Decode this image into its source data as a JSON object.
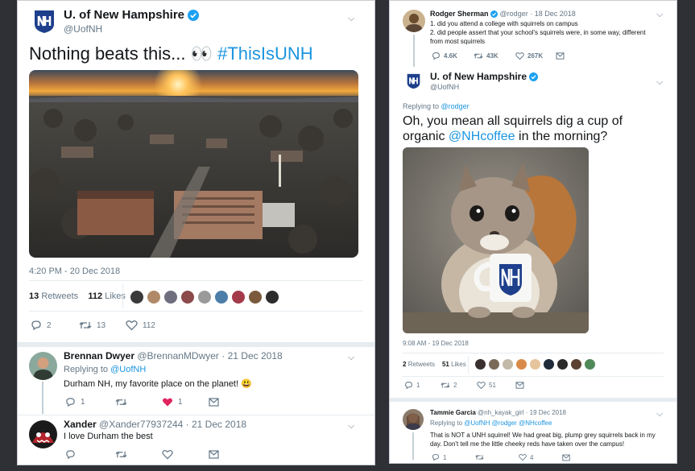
{
  "left": {
    "tweet": {
      "name": "U. of New Hampshire",
      "handle": "@UofNH",
      "text_main": "Nothing beats this... 👀 ",
      "hashtag": "#ThisIsUNH",
      "timestamp": "4:20 PM - 20 Dec 2018",
      "retweets_count": "13",
      "retweets_label": "Retweets",
      "likes_count": "112",
      "likes_label": "Likes",
      "reply_count": "2",
      "retweet_count": "13",
      "like_count": "112"
    },
    "replies": [
      {
        "name": "Brennan Dwyer",
        "handle": "@BrennanMDwyer",
        "date": "· 21 Dec 2018",
        "replying_prefix": "Replying to ",
        "replying_to": "@UofNH",
        "text": "Durham NH, my favorite place on the planet! 😃",
        "reply_count": "1",
        "retweet_count": "",
        "like_count": "1"
      },
      {
        "name": "Xander",
        "handle": "@Xander77937244",
        "date": "· 21 Dec 2018",
        "text": "I love Durham the best"
      }
    ]
  },
  "right": {
    "parent": {
      "name": "Rodger Sherman",
      "handle": "@rodger",
      "date": "· 18 Dec 2018",
      "line1": "1. did you attend a college with squirrels on campus",
      "line2": "2. did people assert that your school's squirrels were, in some way, different from most squirrels",
      "reply_count": "4.6K",
      "retweet_count": "43K",
      "like_count": "267K"
    },
    "tweet": {
      "name": "U. of New Hampshire",
      "handle": "@UofNH",
      "replying_prefix": "Replying to ",
      "replying_to": "@rodger",
      "text_pre": "Oh, you mean all squirrels dig a cup of organic ",
      "mention": "@NHcoffee",
      "text_post": " in the morning?",
      "timestamp": "9:08 AM - 19 Dec 2018",
      "retweets_count": "2",
      "retweets_label": "Retweets",
      "likes_count": "51",
      "likes_label": "Likes",
      "reply_count": "1",
      "retweet_count": "2",
      "like_count": "51"
    },
    "reply": {
      "name": "Tammie Garcia",
      "handle": "@nh_kayak_girl",
      "date": "· 19 Dec 2018",
      "replying_prefix": "Replying to ",
      "replying_to": "@UofNH @rodger @NHcoffee",
      "text": "That is NOT a UNH squirrel! We had great big, plump grey squirrels back in my day. Don't tell me the little cheeky reds have taken over the campus!",
      "reply_count": "1",
      "retweet_count": "",
      "like_count": "4"
    }
  },
  "colors": {
    "background": "#2f3036",
    "link": "#1b95e0",
    "muted": "#657786",
    "verified": "#1da1f2",
    "unh_blue": "#1d3f8c",
    "liked_red": "#e0245e"
  },
  "icons": [
    "reply-icon",
    "retweet-icon",
    "like-icon",
    "heart-filled-icon",
    "dm-icon",
    "verified-icon",
    "chevron-down-icon",
    "unh-logo"
  ]
}
